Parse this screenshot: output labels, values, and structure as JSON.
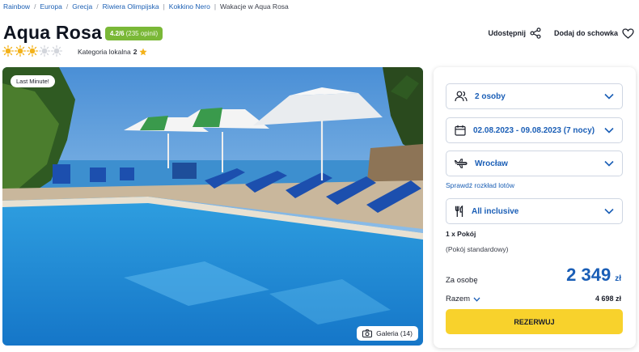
{
  "breadcrumb": [
    "Rainbow",
    "Europa",
    "Grecja",
    "Riwiera Olimpijska",
    "Kokkino Nero",
    "Wakacje w Aqua Rosa"
  ],
  "breadcrumb_separators": [
    "/",
    "/",
    "/",
    "|",
    "|"
  ],
  "hotel": {
    "name": "Aqua Rosa",
    "rating": "4.2/6",
    "reviews": "(235 opinii)",
    "suns_filled": 3,
    "suns_total": 5,
    "category_label": "Kategoria lokalna",
    "category_value": "2"
  },
  "actions": {
    "share": "Udostępnij",
    "favorite": "Dodaj do schowka"
  },
  "photo": {
    "badge": "Last Minute!",
    "gallery": "Galeria (14)"
  },
  "booking": {
    "persons": "2 osoby",
    "dates": "02.08.2023 - 09.08.2023 (7 nocy)",
    "departure": "Wrocław",
    "flights_link": "Sprawdź rozkład lotów",
    "board": "All inclusive",
    "room_count": "1 x Pokój",
    "room_type": "(Pokój standardowy)",
    "per_person_label": "Za osobę",
    "per_person_price": "2 349",
    "currency": "zł",
    "total_label": "Razem",
    "total_value": "4 698 zł",
    "book_button": "REZERWUJ"
  },
  "colors": {
    "accent": "#1a5eb6",
    "badge": "#7ab837",
    "sun": "#f3b21b",
    "book": "#f8d22c"
  }
}
